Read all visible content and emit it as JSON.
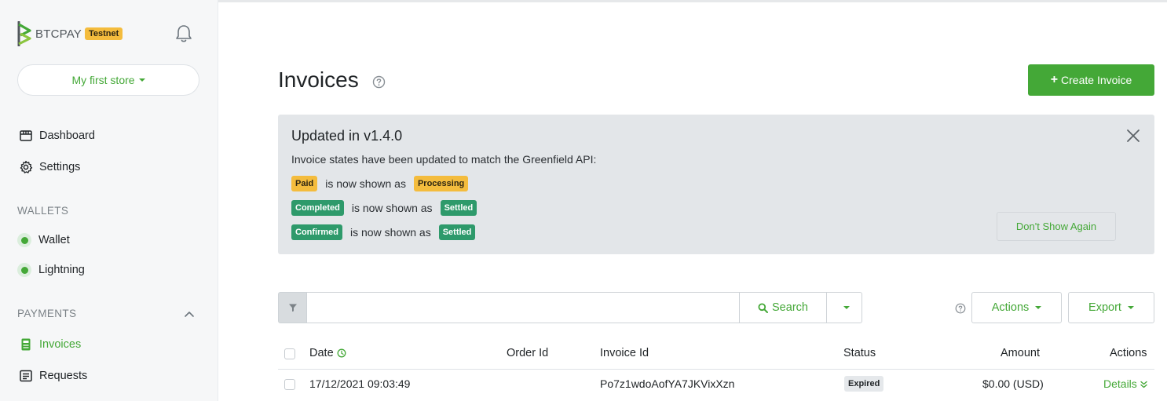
{
  "brand": {
    "name": "BTCPAY",
    "badge": "Testnet"
  },
  "store": {
    "name": "My first store"
  },
  "nav": {
    "dashboard": "Dashboard",
    "settings": "Settings",
    "wallets_heading": "WALLETS",
    "wallet": "Wallet",
    "lightning": "Lightning",
    "payments_heading": "PAYMENTS",
    "invoices": "Invoices",
    "requests": "Requests"
  },
  "page": {
    "title": "Invoices",
    "create_label": "Create Invoice",
    "create_plus": "+"
  },
  "alert": {
    "title": "Updated in v1.4.0",
    "text": "Invoice states have been updated to match the Greenfield API:",
    "rows": [
      {
        "from": "Paid",
        "joiner": "is now shown as",
        "to": "Processing"
      },
      {
        "from": "Completed",
        "joiner": "is now shown as",
        "to": "Settled"
      },
      {
        "from": "Confirmed",
        "joiner": "is now shown as",
        "to": "Settled"
      }
    ],
    "dismiss_label": "Don't Show Again"
  },
  "filter": {
    "search_value": "",
    "search_label": "Search",
    "actions_label": "Actions",
    "export_label": "Export"
  },
  "table": {
    "headers": {
      "date": "Date",
      "order_id": "Order Id",
      "invoice_id": "Invoice Id",
      "status": "Status",
      "amount": "Amount",
      "actions": "Actions"
    },
    "rows": [
      {
        "date": "17/12/2021 09:03:49",
        "order_id": "",
        "invoice_id": "Po7z1wdoAofYA7JKVixXzn",
        "status": "Expired",
        "amount": "$0.00 (USD)",
        "details": "Details"
      }
    ]
  },
  "colors": {
    "accent": "#44a837",
    "warning": "#f4bc3d",
    "success": "#2e9a6b",
    "alert_bg": "#e3e6e9",
    "sidebar_bg": "#f6f7f8"
  },
  "icons": {
    "logo": "btcpay-logo-icon",
    "bell": "bell-icon",
    "dashboard": "store-icon",
    "settings": "gear-icon",
    "invoices": "invoice-icon",
    "requests": "list-icon",
    "help": "question-circle-icon",
    "close": "close-icon",
    "filter": "filter-icon",
    "search": "search-icon",
    "sort": "clock-icon",
    "collapse": "chevron-up-icon"
  }
}
